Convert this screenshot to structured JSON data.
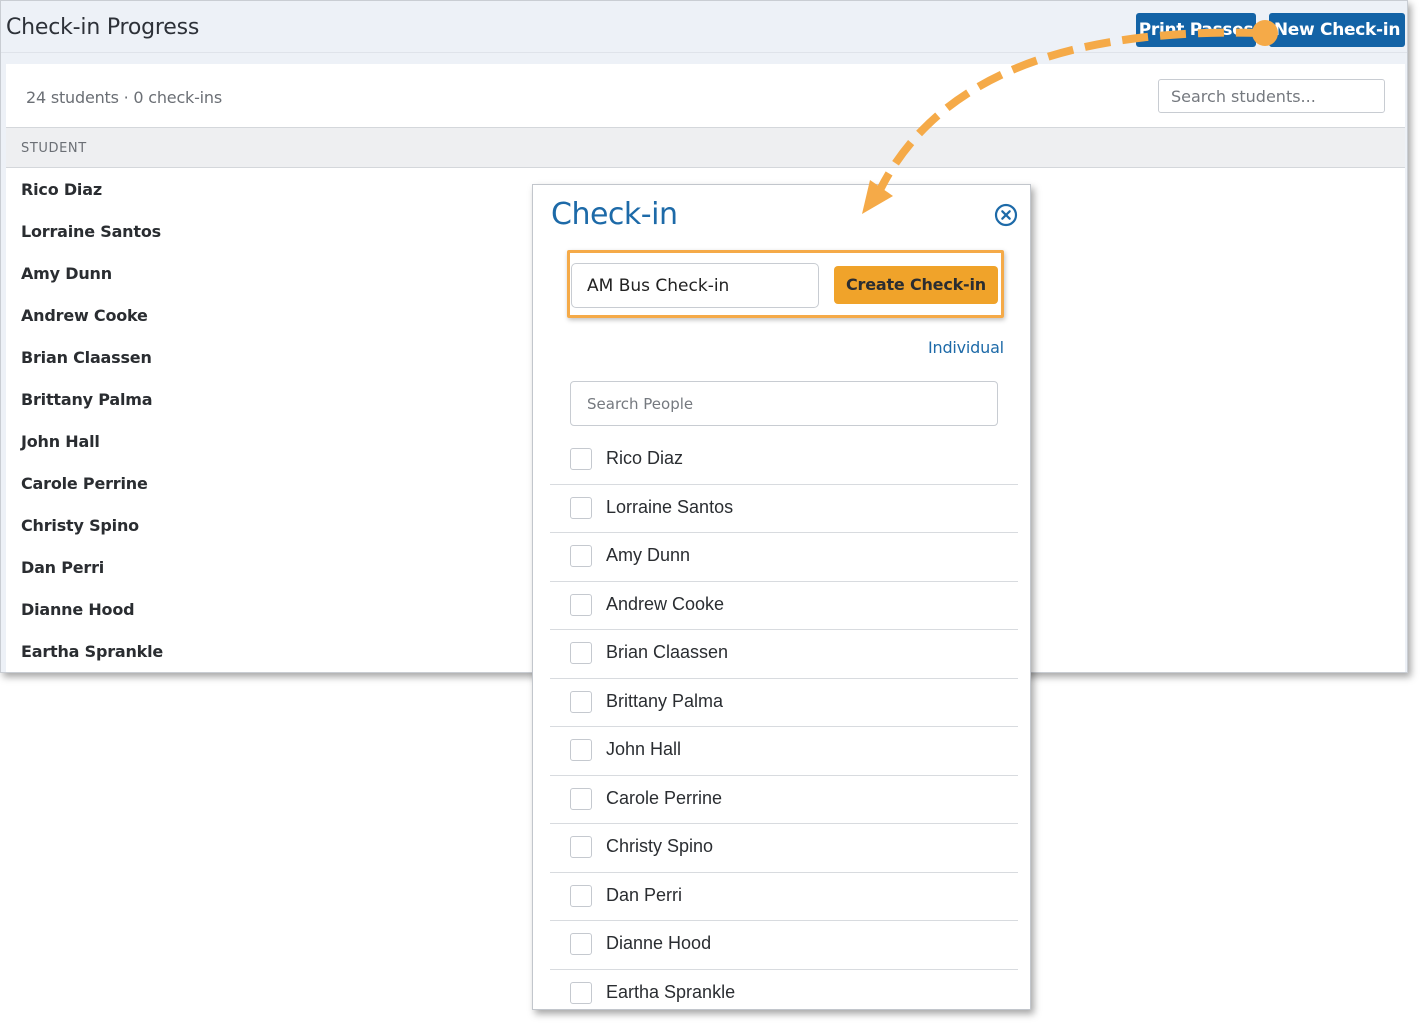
{
  "page": {
    "title": "Check-in Progress",
    "print_passes_label": "Print Passes",
    "new_checkin_label": "New Check-in",
    "summary": "24 students · 0 check-ins",
    "search_placeholder": "Search students...",
    "column_header": "STUDENT",
    "students": [
      "Rico Diaz",
      "Lorraine Santos",
      "Amy Dunn",
      "Andrew Cooke",
      "Brian Claassen",
      "Brittany Palma",
      "John Hall",
      "Carole Perrine",
      "Christy Spino",
      "Dan Perri",
      "Dianne Hood",
      "Eartha Sprankle"
    ]
  },
  "modal": {
    "title": "Check-in",
    "close_icon": "close-circle-icon",
    "checkin_name_value": "AM Bus Check-in",
    "create_label": "Create Check-in",
    "individual_link": "Individual",
    "search_placeholder": "Search People",
    "people": [
      {
        "name": "Rico Diaz",
        "checked": false
      },
      {
        "name": "Lorraine Santos",
        "checked": false
      },
      {
        "name": "Amy Dunn",
        "checked": false
      },
      {
        "name": "Andrew Cooke",
        "checked": false
      },
      {
        "name": "Brian Claassen",
        "checked": false
      },
      {
        "name": "Brittany Palma",
        "checked": false
      },
      {
        "name": "John Hall",
        "checked": false
      },
      {
        "name": "Carole Perrine",
        "checked": false
      },
      {
        "name": "Christy Spino",
        "checked": false
      },
      {
        "name": "Dan Perri",
        "checked": false
      },
      {
        "name": "Dianne Hood",
        "checked": false
      },
      {
        "name": "Eartha Sprankle",
        "checked": false
      }
    ]
  },
  "colors": {
    "primary_blue": "#1363a6",
    "accent_orange": "#f0a32a",
    "highlight_orange": "#f5aa48"
  }
}
